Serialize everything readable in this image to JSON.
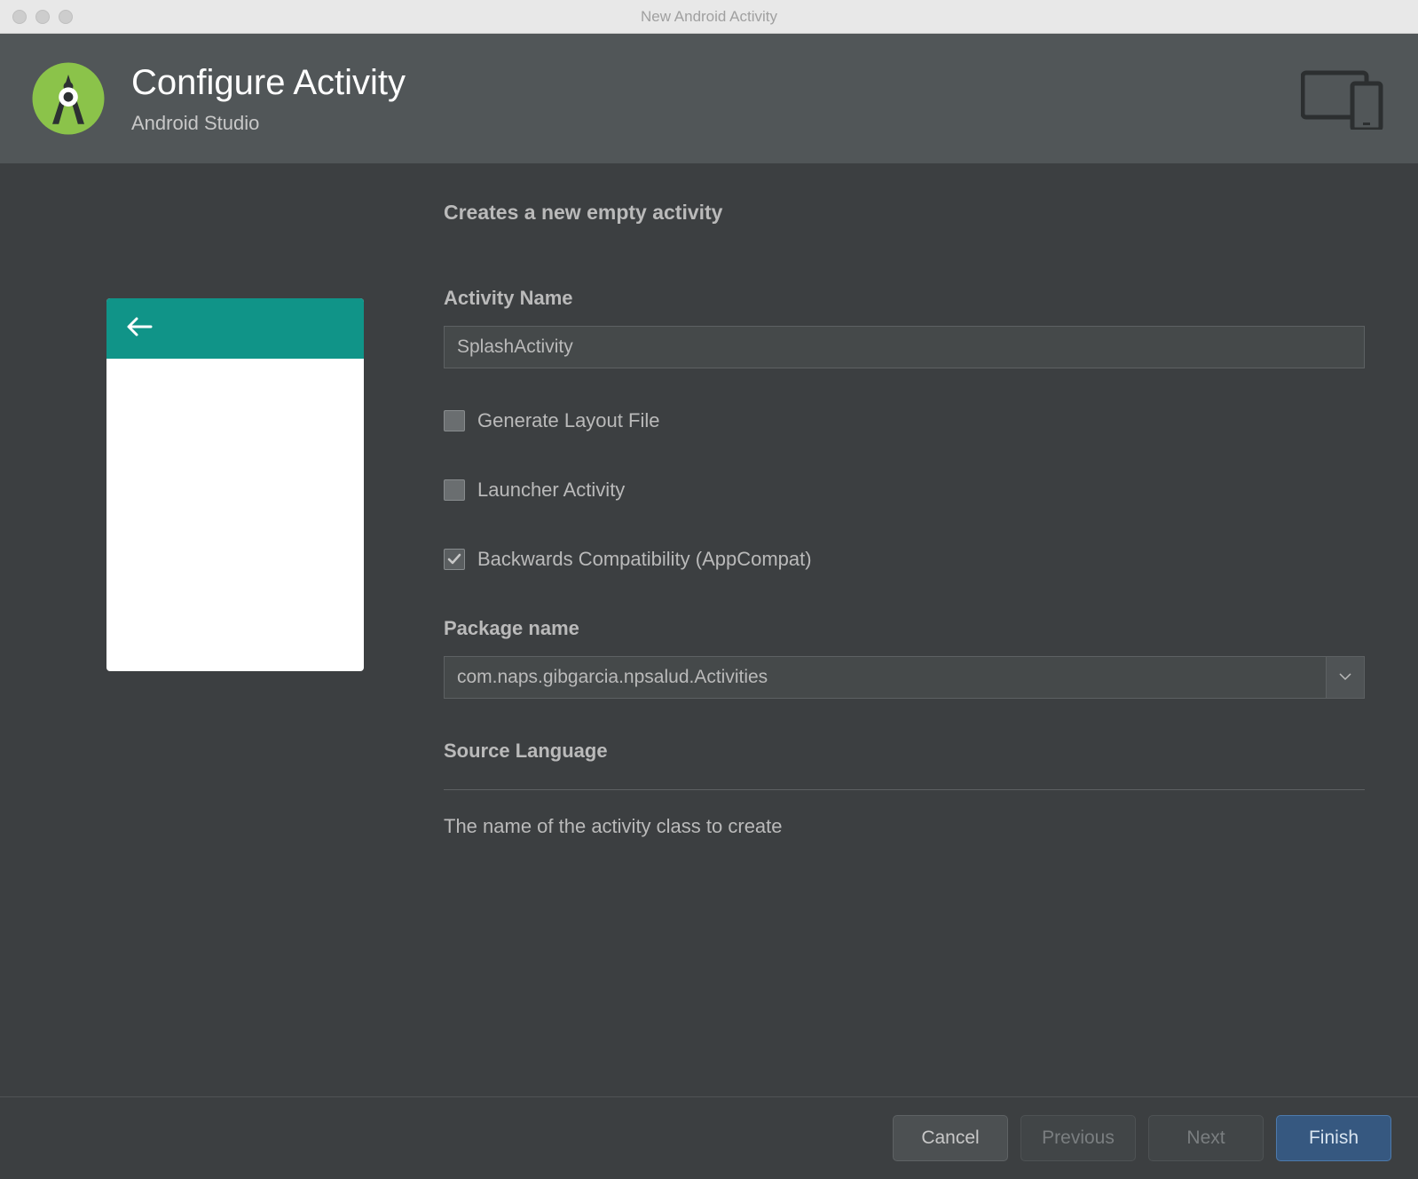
{
  "window": {
    "title": "New Android Activity"
  },
  "header": {
    "title": "Configure Activity",
    "subtitle": "Android Studio"
  },
  "form": {
    "heading": "Creates a new empty activity",
    "activity_name_label": "Activity Name",
    "activity_name_value": "SplashActivity",
    "generate_layout_label": "Generate Layout File",
    "launcher_activity_label": "Launcher Activity",
    "backwards_compat_label": "Backwards Compatibility (AppCompat)",
    "package_name_label": "Package name",
    "package_name_value": "com.naps.gibgarcia.npsalud.Activities",
    "source_language_label": "Source Language",
    "help_text": "The name of the activity class to create"
  },
  "footer": {
    "cancel": "Cancel",
    "previous": "Previous",
    "next": "Next",
    "finish": "Finish"
  }
}
